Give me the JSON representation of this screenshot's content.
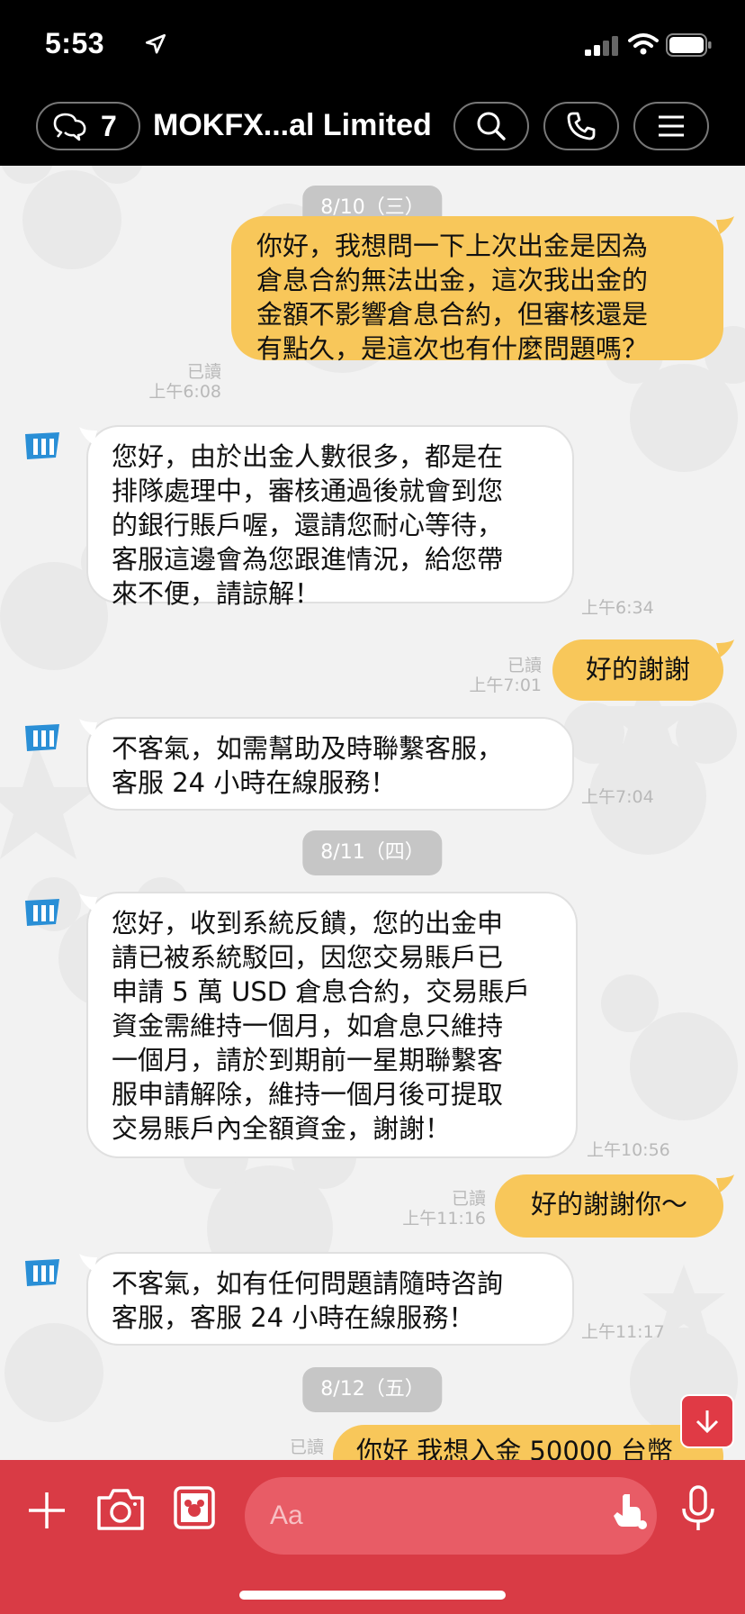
{
  "status_bar": {
    "time": "5:53"
  },
  "header": {
    "back_count": "7",
    "title": "MOKFX...al Limited"
  },
  "dates": [
    "8/10（三）",
    "8/11（四）",
    "8/12（五）"
  ],
  "messages": [
    {
      "dir": "out",
      "text": "你好，我想問一下上次出金是因為\n倉息合約無法出金，這次我出金的\n金額不影響倉息合約，但審核還是\n有點久，是這次也有什麼問題嗎？",
      "read": "已讀",
      "time": "上午6:08"
    },
    {
      "dir": "in",
      "text": "您好，由於出金人數很多，都是在\n排隊處理中，審核通過後就會到您\n的銀行賬戶喔，還請您耐心等待，\n客服這邊會為您跟進情況，給您帶\n來不便，請諒解！",
      "time": "上午6:34"
    },
    {
      "dir": "out",
      "text": "好的謝謝",
      "read": "已讀",
      "time": "上午7:01"
    },
    {
      "dir": "in",
      "text": "不客氣，如需幫助及時聯繫客服，\n客服 24 小時在線服務！",
      "time": "上午7:04"
    },
    {
      "dir": "in",
      "text": "您好，收到系統反饋，您的出金申\n請已被系統駁回，因您交易賬戶已\n申請 5 萬 USD 倉息合約，交易賬戶\n資金需維持一個月，如倉息只維持\n一個月，請於到期前一星期聯繫客\n服申請解除，維持一個月後可提取\n交易賬戶內全額資金，謝謝！",
      "time": "上午10:56"
    },
    {
      "dir": "out",
      "text": "好的謝謝你～",
      "read": "已讀",
      "time": "上午11:16"
    },
    {
      "dir": "in",
      "text": "不客氣，如有任何問題請隨時咨詢\n客服，客服 24 小時在線服務！",
      "time": "上午11:17"
    },
    {
      "dir": "out",
      "text": "你好 我想入金 50000 台幣",
      "read": "已讀",
      "time": ""
    }
  ],
  "composer": {
    "placeholder": "Aa"
  },
  "colors": {
    "outgoing_bubble": "#f8c75a",
    "incoming_bubble": "#ffffff",
    "composer_bg": "#d93b45",
    "header_bg": "#000000"
  },
  "icons": [
    "location-arrow-icon",
    "signal-icon",
    "wifi-icon",
    "battery-icon",
    "chat-bubbles-icon",
    "search-icon",
    "phone-icon",
    "menu-icon",
    "avatar-logo-icon",
    "arrow-down-icon",
    "plus-icon",
    "camera-icon",
    "image-icon",
    "emoji-icon",
    "mic-icon"
  ]
}
